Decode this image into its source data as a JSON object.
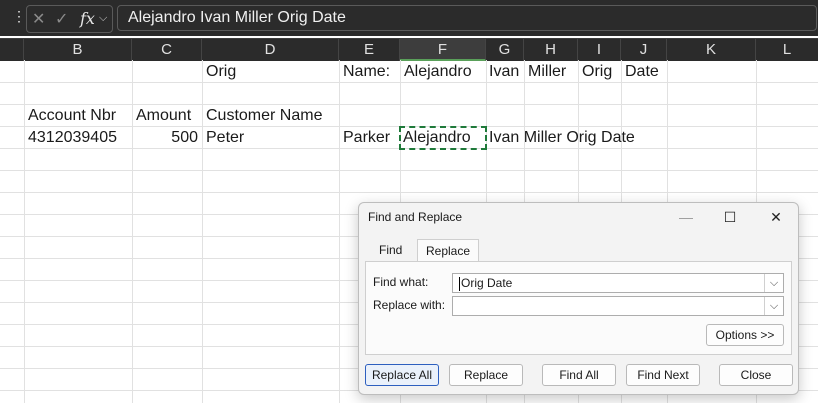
{
  "formula_bar": {
    "dots": "⋮",
    "cancel_icon": "✕",
    "enter_icon": "✓",
    "fx_label": "fx",
    "formula": "Alejandro Ivan Miller Orig Date"
  },
  "columns": [
    "B",
    "C",
    "D",
    "E",
    "F",
    "G",
    "H",
    "I",
    "J",
    "K",
    "L"
  ],
  "selected_column": "F",
  "cells": {
    "row1": {
      "D": "Orig",
      "E": "Name:",
      "F": "Alejandro",
      "G": "Ivan",
      "H": "Miller",
      "I": "Orig",
      "J": "Date"
    },
    "row3": {
      "B": "Account Nbr",
      "C": "Amount",
      "D": "Customer Name"
    },
    "row4": {
      "B": "4312039405",
      "C": "500",
      "D": "Peter",
      "E": "Parker",
      "F": "Alejandro",
      "G": "Ivan Miller Orig Date"
    }
  },
  "dialog": {
    "title": "Find and Replace",
    "minimize": "—",
    "maximize": "☐",
    "close": "✕",
    "tabs": [
      "Find",
      "Replace"
    ],
    "active_tab": "Replace",
    "find_what_label": "Find what:",
    "find_what_value": "Orig Date",
    "replace_with_label": "Replace with:",
    "replace_with_value": "",
    "options_button": "Options >>",
    "buttons": {
      "replace_all": "Replace All",
      "replace": "Replace",
      "find_all": "Find All",
      "find_next": "Find Next",
      "close": "Close"
    }
  }
}
